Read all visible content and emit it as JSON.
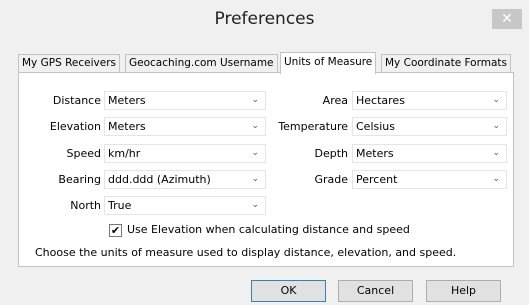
{
  "window": {
    "title": "Preferences",
    "close_glyph": "✕"
  },
  "tabs": [
    {
      "label": "My GPS Receivers"
    },
    {
      "label": "Geocaching.com Username"
    },
    {
      "label": "Units of Measure"
    },
    {
      "label": "My Coordinate Formats"
    }
  ],
  "fields": {
    "distance": {
      "label": "Distance",
      "value": "Meters"
    },
    "elevation": {
      "label": "Elevation",
      "value": "Meters"
    },
    "speed": {
      "label": "Speed",
      "value": "km/hr"
    },
    "bearing": {
      "label": "Bearing",
      "value": "ddd.ddd (Azimuth)"
    },
    "north": {
      "label": "North",
      "value": "True"
    },
    "area": {
      "label": "Area",
      "value": "Hectares"
    },
    "temperature": {
      "label": "Temperature",
      "value": "Celsius"
    },
    "depth": {
      "label": "Depth",
      "value": "Meters"
    },
    "grade": {
      "label": "Grade",
      "value": "Percent"
    }
  },
  "chevron_glyph": "⌄",
  "use_elevation": {
    "checked_glyph": "✔",
    "label": "Use Elevation when calculating distance and speed"
  },
  "hint": "Choose the units of measure used to display distance, elevation, and speed.",
  "buttons": {
    "ok": "OK",
    "cancel": "Cancel",
    "help": "Help"
  }
}
